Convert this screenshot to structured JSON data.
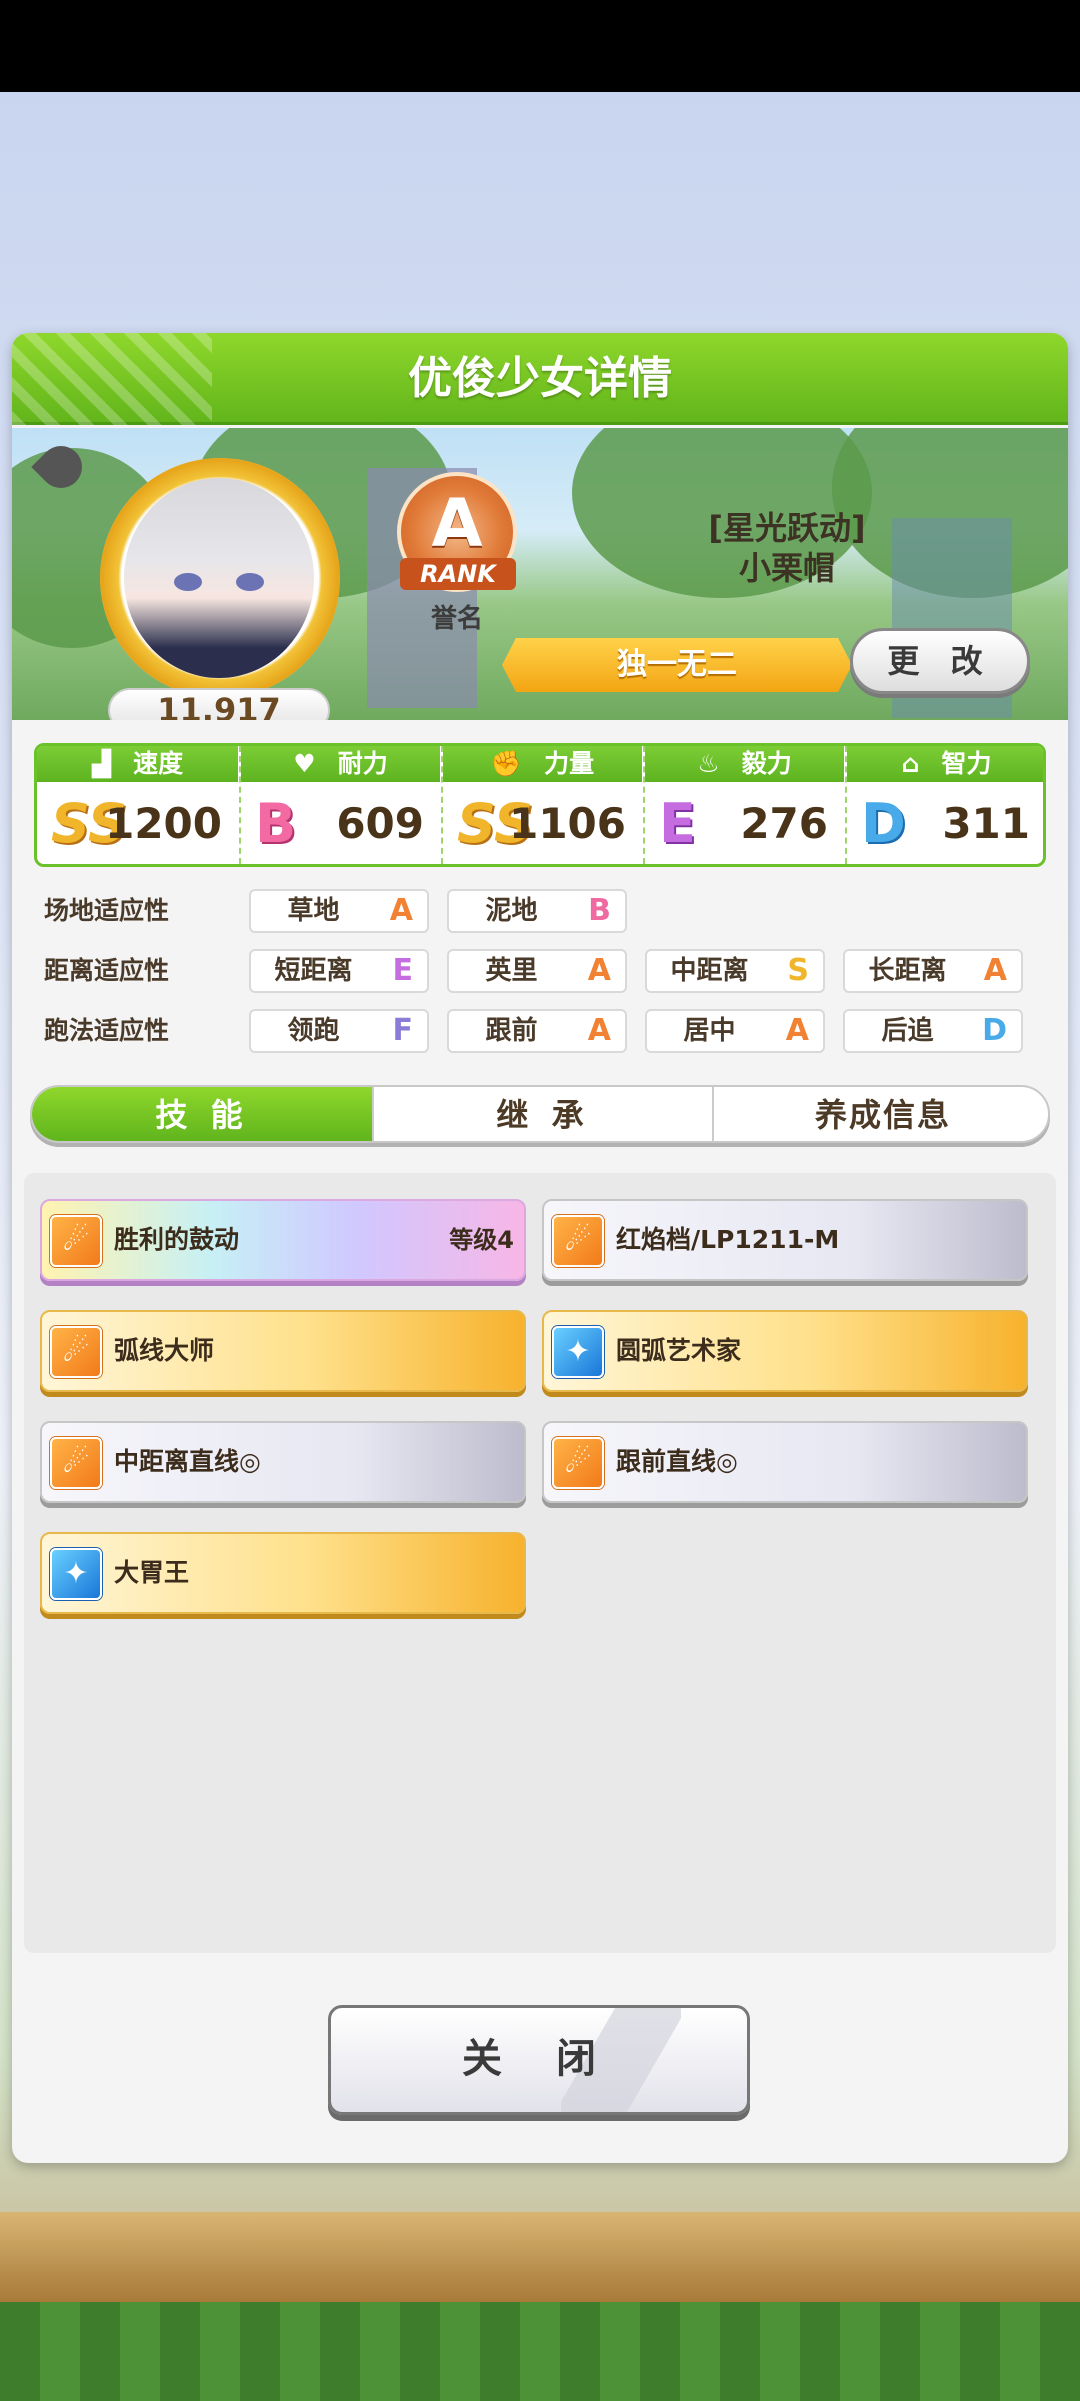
{
  "dialog": {
    "title": "优俊少女详情"
  },
  "profile": {
    "score": "11,917",
    "rank_letter": "A",
    "rank_label": "RANK",
    "honor_label": "誉名",
    "epithet": "[星光跃动]",
    "name": "小栗帽",
    "title": "独一无二",
    "change_button": "更 改"
  },
  "stats": [
    {
      "label": "速度",
      "grade": "SS",
      "value": "1200"
    },
    {
      "label": "耐力",
      "grade": "B",
      "value": "609"
    },
    {
      "label": "力量",
      "grade": "SS",
      "value": "1106"
    },
    {
      "label": "毅力",
      "grade": "E",
      "value": "276"
    },
    {
      "label": "智力",
      "grade": "D",
      "value": "311"
    }
  ],
  "aptitude": {
    "track": {
      "label": "场地适应性",
      "items": [
        {
          "name": "草地",
          "grade": "A"
        },
        {
          "name": "泥地",
          "grade": "B"
        }
      ]
    },
    "distance": {
      "label": "距离适应性",
      "items": [
        {
          "name": "短距离",
          "grade": "E"
        },
        {
          "name": "英里",
          "grade": "A"
        },
        {
          "name": "中距离",
          "grade": "S"
        },
        {
          "name": "长距离",
          "grade": "A"
        }
      ]
    },
    "style": {
      "label": "跑法适应性",
      "items": [
        {
          "name": "领跑",
          "grade": "F"
        },
        {
          "name": "跟前",
          "grade": "A"
        },
        {
          "name": "居中",
          "grade": "A"
        },
        {
          "name": "后追",
          "grade": "D"
        }
      ]
    }
  },
  "tabs": [
    {
      "label": "技 能"
    },
    {
      "label": "继 承"
    },
    {
      "label": "养成信息"
    }
  ],
  "skills": [
    {
      "name": "胜利的鼓动",
      "level": "等级4",
      "style": "rainbow",
      "icon": "runner-icon"
    },
    {
      "name": "红焰档/LP1211-M",
      "style": "normal",
      "icon": "runner-icon"
    },
    {
      "name": "弧线大师",
      "style": "gold",
      "icon": "runner-icon"
    },
    {
      "name": "圆弧艺术家",
      "style": "gold",
      "icon": "sparkle-icon"
    },
    {
      "name": "中距离直线◎",
      "style": "normal",
      "icon": "runner-icon"
    },
    {
      "name": "跟前直线◎",
      "style": "normal",
      "icon": "runner-icon"
    },
    {
      "name": "大胃王",
      "style": "gold",
      "icon": "sparkle-icon"
    }
  ],
  "close_button": "关 闭",
  "colors": {
    "accent_green": "#6bc12a",
    "gold": "#f3a513"
  }
}
